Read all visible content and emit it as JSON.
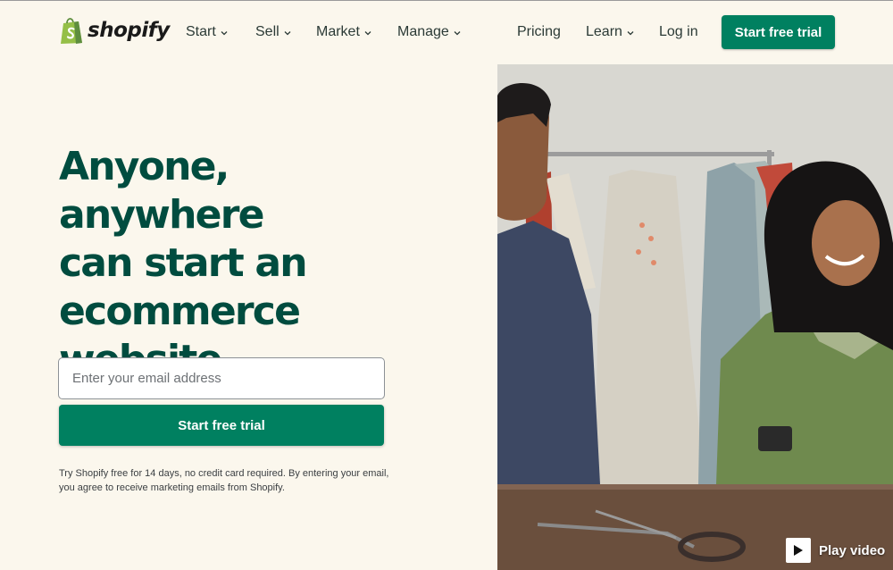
{
  "brand": {
    "name": "shopify",
    "color": "#008060",
    "logo_icon": "shopping-bag-logo-icon"
  },
  "nav": {
    "items": [
      {
        "label": "Start",
        "has_dropdown": true
      },
      {
        "label": "Sell",
        "has_dropdown": true
      },
      {
        "label": "Market",
        "has_dropdown": true
      },
      {
        "label": "Manage",
        "has_dropdown": true
      }
    ],
    "pricing": "Pricing",
    "learn": {
      "label": "Learn",
      "has_dropdown": true
    },
    "login": "Log in",
    "cta": "Start free trial"
  },
  "hero": {
    "title_lines": [
      "Anyone, anywhere",
      "can start an",
      "ecommerce",
      "website"
    ],
    "email_placeholder": "Enter your email address",
    "cta": "Start free trial",
    "disclaimer": "Try Shopify free for 14 days, no credit card required. By entering your email, you agree to receive marketing emails from Shopify.",
    "play_video": "Play video"
  },
  "colors": {
    "background": "#fbf7ed",
    "heading": "#004c3f",
    "button": "#008060"
  }
}
